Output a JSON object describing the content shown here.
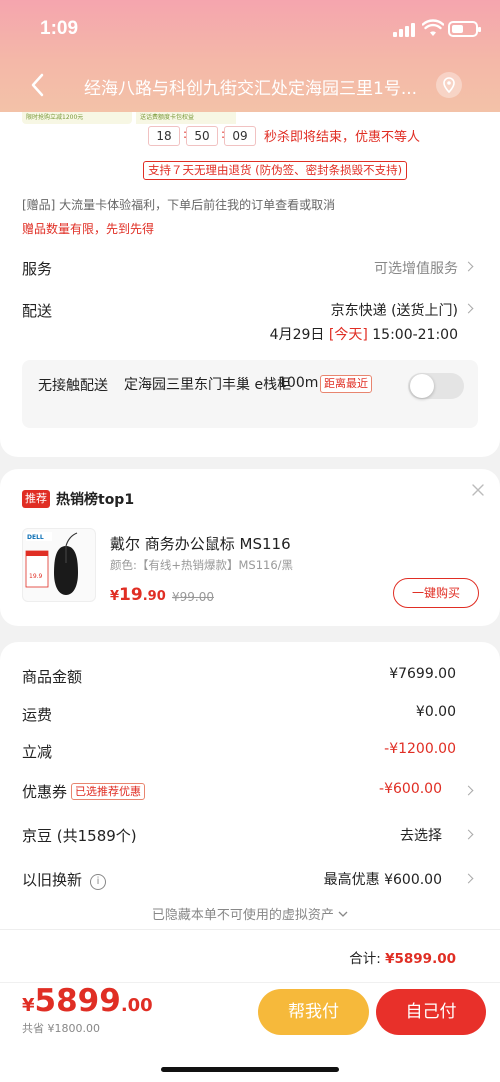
{
  "status_bar": {
    "time": "1:09"
  },
  "header": {
    "address": "经海八路与科创九街交汇处定海园三里1号..."
  },
  "promo": {
    "thumb_text_1": "限时抢购立减1200元",
    "thumb_text_2": "送话费额度卡包权益",
    "countdown": {
      "h": "18",
      "m": "50",
      "s": "09"
    },
    "flash_text": "秒杀即将结束，优惠不等人",
    "return_policy": "支持７天无理由退货 (防伪签、密封条损毁不支持)",
    "gift_text": "[赠品] 大流量卡体验福利，下单后前往我的订单查看或取消",
    "gift_warning": "赠品数量有限，先到先得"
  },
  "service": {
    "label": "服务",
    "value": "可选增值服务"
  },
  "delivery": {
    "label": "配送",
    "method": "京东快递 (送货上门)",
    "date": "4月29日",
    "today_tag": "[今天]",
    "slot": "15:00-21:00",
    "contactless_label": "无接触配送",
    "pickup_place": "定海园三里东门丰巢 e栈柜",
    "distance": "100m",
    "nearest_tag": "距离最近"
  },
  "recommend": {
    "badge": "推荐",
    "title": "热销榜top1",
    "product_name": "戴尔 商务办公鼠标 MS116",
    "product_spec": "颜色:【有线+热销爆款】MS116/黑",
    "price_symbol": "¥",
    "price_int": "19",
    "price_dec": ".90",
    "orig_price": "¥99.00",
    "buy_label": "一键购买",
    "img_brand": "DELL",
    "img_price": "19.9"
  },
  "summary": {
    "goods_label": "商品金额",
    "goods_value": "¥7699.00",
    "shipping_label": "运费",
    "shipping_value": "¥0.00",
    "discount_label": "立减",
    "discount_value": "-¥1200.00",
    "coupon_label": "优惠券",
    "coupon_tag": "已选推荐优惠",
    "coupon_value": "-¥600.00",
    "beans_label": "京豆 (共1589个)",
    "beans_value": "去选择",
    "tradein_label": "以旧换新",
    "tradein_value": "最高优惠 ¥600.00",
    "hidden_note": "已隐藏本单不可使用的虚拟资产",
    "total_label": "合计:",
    "total_value": "¥5899.00"
  },
  "bottom": {
    "currency": "¥",
    "price_int": "5899",
    "price_dec": ".00",
    "saved": "共省 ¥1800.00",
    "help_pay": "帮我付",
    "self_pay": "自己付"
  },
  "colors": {
    "accent_red": "#e02e24",
    "help_yellow": "#f6b93b",
    "pay_red": "#e8302a"
  }
}
